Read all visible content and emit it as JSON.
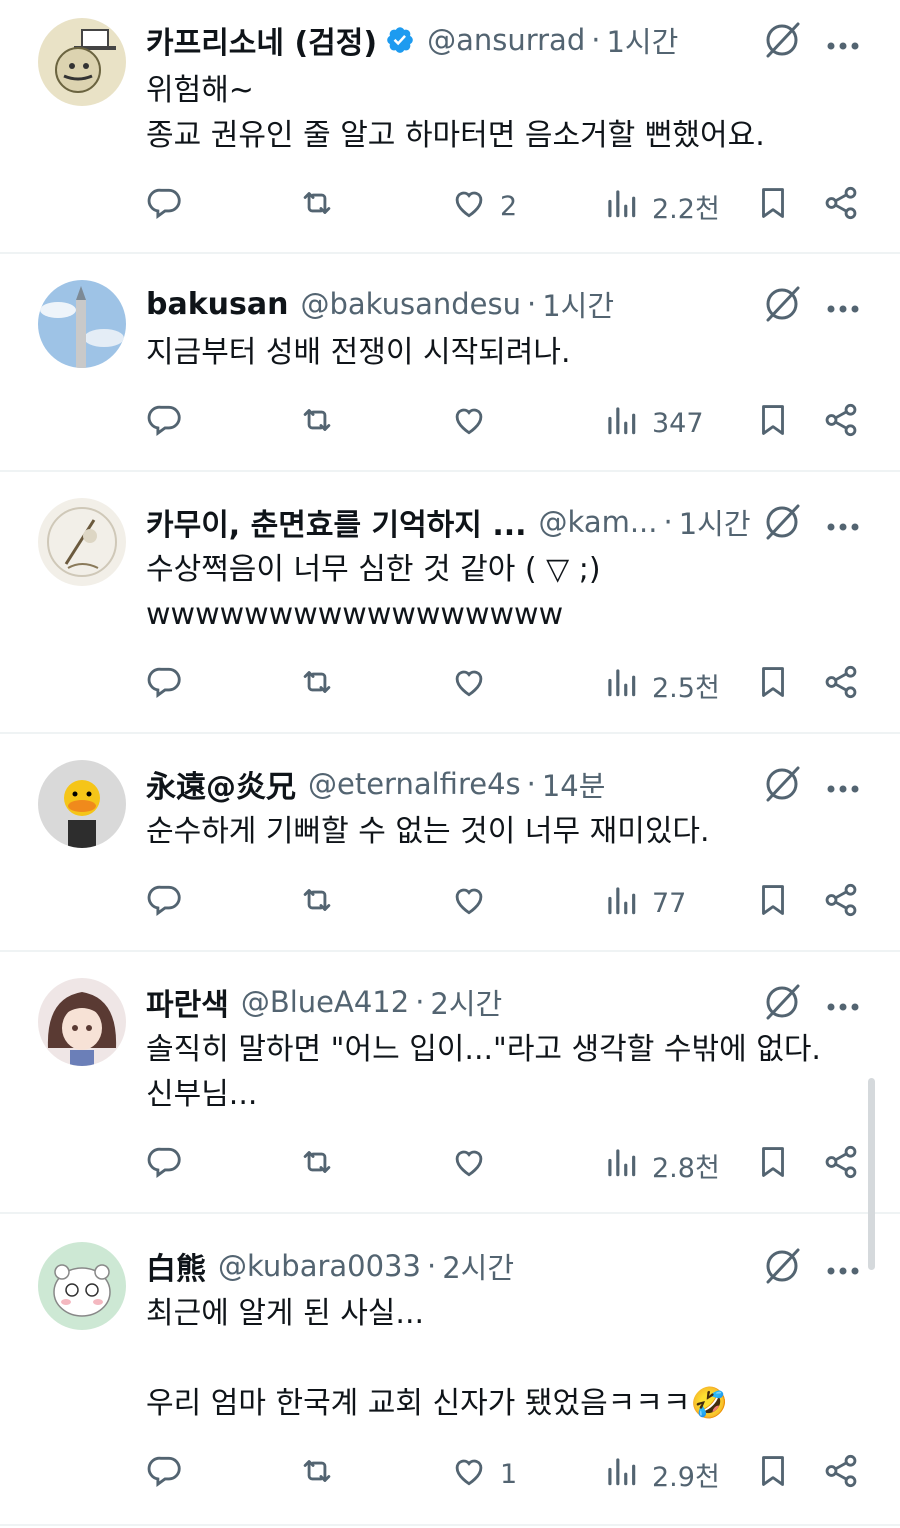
{
  "tweets": [
    {
      "display_name": "카프리소네 (검정)",
      "verified": true,
      "handle": "@ansurrad",
      "time": "1시간",
      "text": "위험해~\n종교 권유인 줄 알고 하마터면 음소거할 뻔했어요.",
      "likes": "2",
      "views": "2.2천"
    },
    {
      "display_name": "bakusan",
      "verified": false,
      "handle": "@bakusandesu",
      "time": "1시간",
      "text": "지금부터 성배 전쟁이 시작되려나.",
      "likes": "",
      "views": "347"
    },
    {
      "display_name": "카무이, 춘면효를 기억하지 ...",
      "verified": false,
      "handle": "@kam...",
      "time": "1시간",
      "text": "수상쩍음이 너무 심한 것 같아 ( ▽ ;)\nwwwwwwwwwwwwwwwww",
      "likes": "",
      "views": "2.5천"
    },
    {
      "display_name": "永遠@炎兄",
      "verified": false,
      "handle": "@eternalfire4s",
      "time": "14분",
      "text": "순수하게 기뻐할 수 없는 것이 너무 재미있다.",
      "likes": "",
      "views": "77"
    },
    {
      "display_name": "파란색",
      "verified": false,
      "handle": "@BlueA412",
      "time": "2시간",
      "text": "솔직히 말하면 \"어느 입이...\"라고 생각할 수밖에 없다.\n신부님...",
      "likes": "",
      "views": "2.8천"
    },
    {
      "display_name": "白熊",
      "verified": false,
      "handle": "@kubara0033",
      "time": "2시간",
      "text": "최근에 알게 된 사실...\n\n우리 엄마 한국계 교회 신자가 됐었음ㅋㅋㅋ🤣",
      "likes": "1",
      "views": "2.9천"
    }
  ],
  "colors": {
    "text": "#0f1419",
    "secondary": "#536471",
    "verified": "#1d9bf0",
    "divider": "#eff3f4"
  },
  "icons": [
    "reply-icon",
    "retweet-icon",
    "like-icon",
    "views-icon",
    "bookmark-icon",
    "share-icon",
    "grok-icon",
    "more-icon",
    "verified-badge-icon"
  ]
}
